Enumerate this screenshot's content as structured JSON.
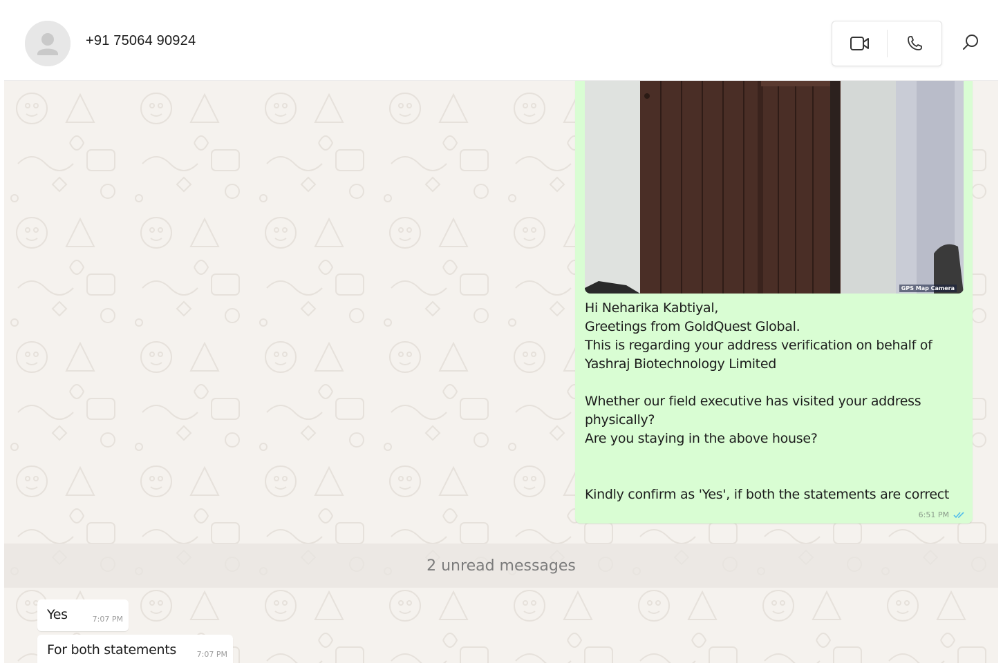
{
  "header": {
    "contact_name": "+91 75064 90924",
    "icons": {
      "avatar": "default-person-avatar",
      "video_call": "video-camera-icon",
      "voice_call": "phone-icon",
      "search": "search-icon"
    }
  },
  "messages": {
    "outgoing": {
      "image_watermark": "GPS Map Camera",
      "text_lines": [
        "Hi Neharika Kabtiyal,",
        "Greetings from GoldQuest Global.",
        "This is regarding your address verification on behalf of",
        "Yashraj Biotechnology Limited",
        "",
        "Whether our field executive has visited your address",
        "physically?",
        "Are you staying in the above house?",
        "",
        "",
        "Kindly confirm as 'Yes', if both the statements are correct"
      ],
      "time": "6:51 PM",
      "status_icon": "double-check-read-icon"
    },
    "unread_divider": "2 unread messages",
    "incoming": [
      {
        "text": "Yes",
        "time": "7:07 PM"
      },
      {
        "text": "For both statements",
        "time": "7:07 PM"
      }
    ]
  },
  "colors": {
    "outgoing_bubble": "#d9fdd3",
    "incoming_bubble": "#ffffff",
    "wallpaper": "#f5f2ee",
    "read_ticks": "#53bdeb"
  }
}
